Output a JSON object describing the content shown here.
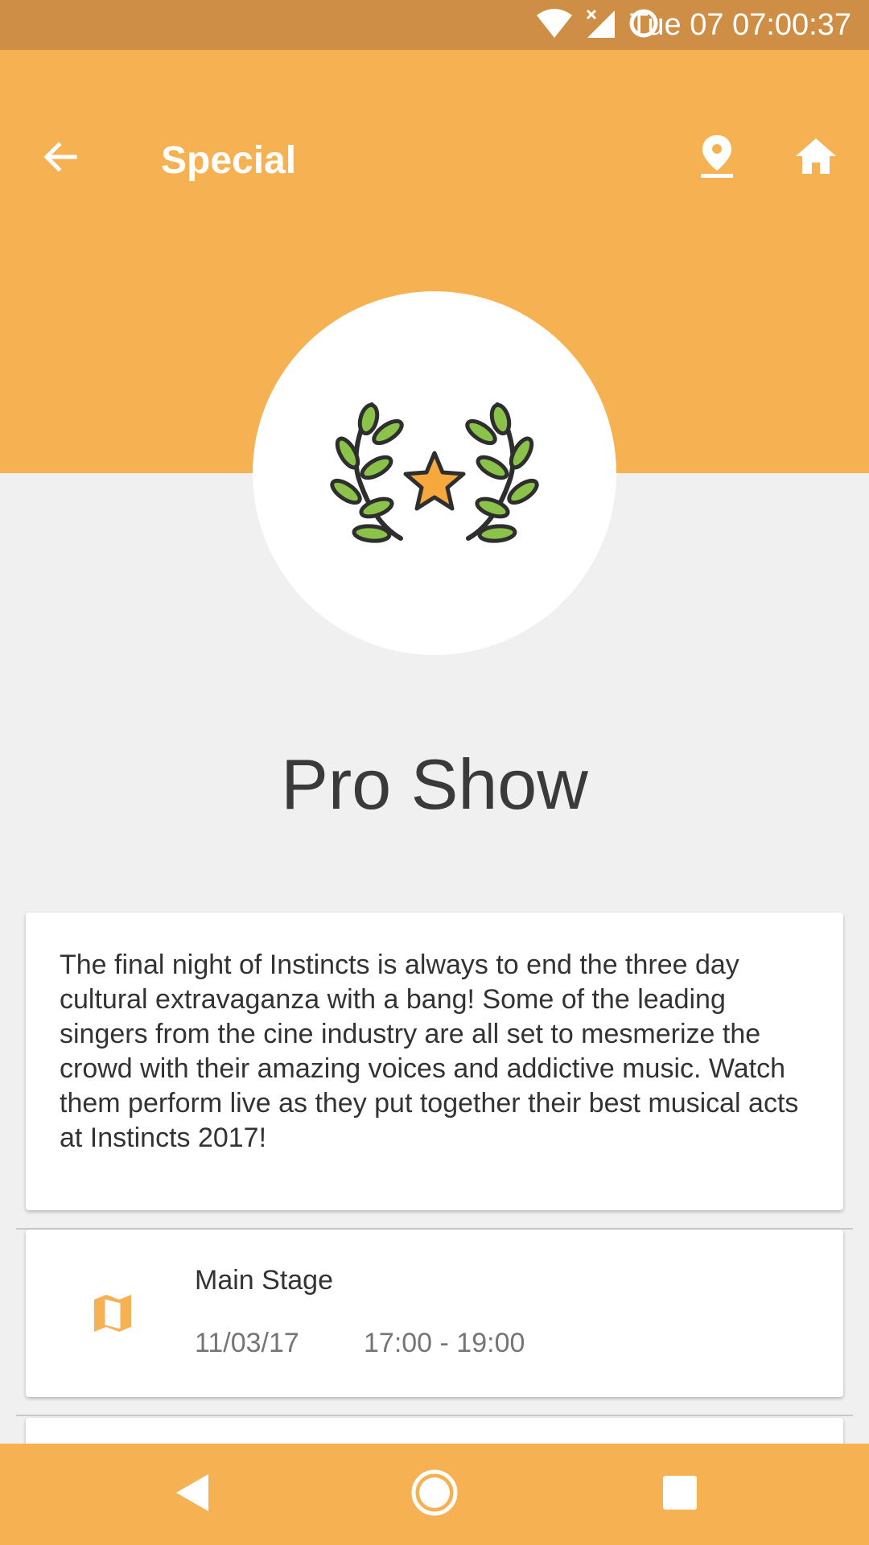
{
  "status_bar": {
    "time": "Tue 07 07:00:37",
    "icons": [
      "wifi-icon",
      "signal-icon",
      "sync-circle-icon"
    ]
  },
  "app_bar": {
    "title": "Special",
    "back_icon": "arrow-back-icon",
    "actions": [
      "location-pin-icon",
      "home-icon"
    ]
  },
  "event": {
    "name": "Pro Show",
    "badge_icon": "laurel-star-icon",
    "description": "The final night of Instincts is always to end the three day cultural extravaganza with a bang! Some of the leading singers from the cine industry are all set to mesmerize the crowd with their amazing voices and addictive music. Watch them perform live as they put together their best musical acts at Instincts 2017!",
    "venue": "Main Stage",
    "date": "11/03/17",
    "time": "17:00 - 19:00",
    "venue_icon": "map-icon"
  },
  "nav_bar": {
    "buttons": [
      "back-triangle-icon",
      "home-circle-icon",
      "recents-square-icon"
    ]
  },
  "colors": {
    "status_bar": "#cf8e45",
    "accent": "#f6b152",
    "background": "#f0f0f0",
    "leaf_green": "#8bc34a",
    "star_orange": "#f7a83c"
  }
}
